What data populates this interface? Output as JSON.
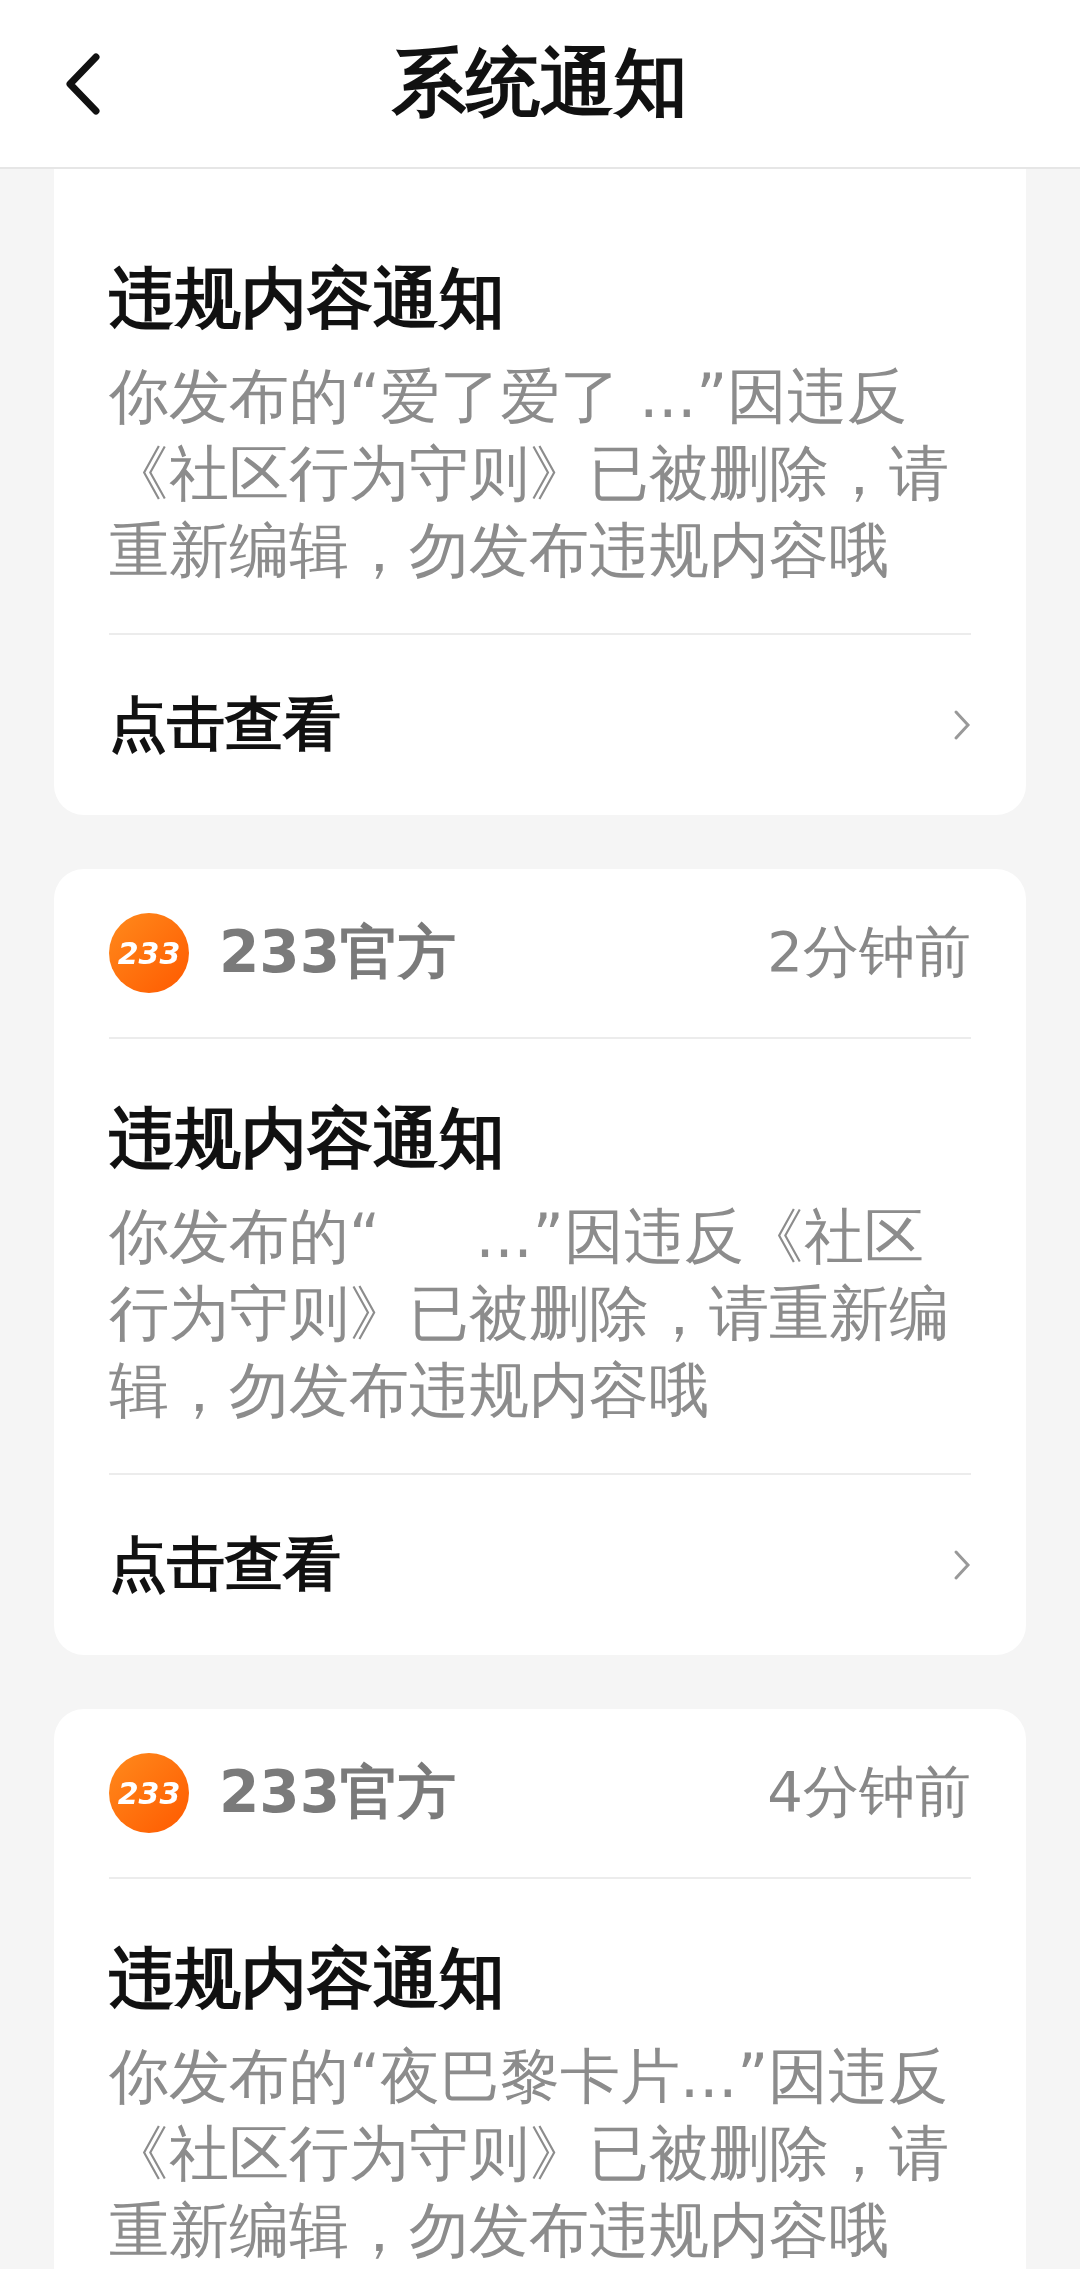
{
  "header": {
    "title": "系统通知"
  },
  "notifications": [
    {
      "title": "违规内容通知",
      "body": "你发布的“爱了爱了 ...”因违反《社区行为守则》已被删除，请重新编辑，勿发布违规内容哦",
      "action": "点击查看"
    },
    {
      "source": {
        "badge": "233",
        "name": "233官方",
        "time": "2分钟前"
      },
      "title": "违规内容通知",
      "body": "你发布的“     ...”因违反《社区行为守则》已被删除，请重新编辑，勿发布违规内容哦",
      "action": "点击查看"
    },
    {
      "source": {
        "badge": "233",
        "name": "233官方",
        "time": "4分钟前"
      },
      "title": "违规内容通知",
      "body": "你发布的“夜巴黎卡片...”因违反《社区行为守则》已被删除，请重新编辑，勿发布违规内容哦"
    }
  ]
}
